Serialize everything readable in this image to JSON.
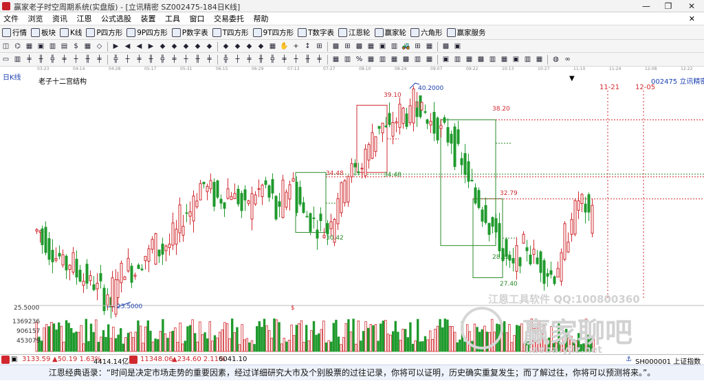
{
  "window": {
    "title": "赢家老子时空周期系统(实盘版) - [立讯精密  SZ002475-184日K线]",
    "min_label": "—",
    "max_label": "❐",
    "close_label": "✕"
  },
  "menu": [
    "文件",
    "浏览",
    "资讯",
    "江恩",
    "公式选股",
    "装置",
    "工具",
    "窗口",
    "交易委托",
    "帮助"
  ],
  "toolbar1": [
    {
      "label": "行情",
      "icon": "quote-icon"
    },
    {
      "label": "板块",
      "icon": "sector-icon"
    },
    {
      "label": "K线",
      "icon": "kline-icon"
    },
    {
      "label": "P四方形",
      "icon": "square-icon"
    },
    {
      "label": "9P四方形",
      "icon": "square9p-icon"
    },
    {
      "label": "P数字表",
      "icon": "number-table-icon"
    },
    {
      "label": "T四方形",
      "icon": "t-square-icon"
    },
    {
      "label": "9T四方形",
      "icon": "t-square9-icon"
    },
    {
      "label": "T数字表",
      "icon": "t-number-icon"
    },
    {
      "label": "江恩轮",
      "icon": "gann-wheel-icon"
    },
    {
      "label": "赢家轮",
      "icon": "winner-wheel-icon"
    },
    {
      "label": "六角形",
      "icon": "hexagon-icon"
    },
    {
      "label": "赢家服务",
      "icon": "service-icon"
    }
  ],
  "toolbar2": [
    "◫",
    "⌬",
    "▦",
    "▣",
    "▥",
    "▤",
    "$",
    "▦",
    "◇",
    "▶",
    "◀",
    "◀",
    "▶",
    "◆",
    "◆",
    "◆",
    "◆",
    "◆",
    "◆",
    "◆",
    "◆",
    "◆",
    "▦",
    "✋",
    "+",
    "↕",
    "⊞",
    "▩",
    "⊞",
    "▩",
    "▦",
    "▣",
    "▥",
    "🚜",
    "⊞",
    "▦",
    "▩",
    "▣"
  ],
  "toolbar3": [
    "▭",
    "▥",
    "╪",
    "╫",
    "╬",
    "╪",
    "┼",
    "╫",
    "╪",
    "╬",
    "┼",
    "╪",
    "╫",
    "╬",
    "╪",
    "┼",
    "╫",
    "╪",
    "╬",
    "┼",
    "╪",
    "╫",
    "╬",
    "╪",
    "┼",
    "╫",
    "╪",
    "▦",
    "▥",
    "%",
    "▦",
    "▥",
    "▦",
    "▩",
    "▥",
    "▦",
    "▣",
    "▥",
    "▦",
    "▩",
    "▥",
    "▦",
    "▣",
    "▥",
    "▦",
    "◍",
    "∞"
  ],
  "date_ruler": [
    "03-23",
    "04-14",
    "04-28",
    "05-17",
    "05-31",
    "06-15",
    "06-29",
    "07-13",
    "07-27",
    "08-10",
    "08-24",
    "09-07",
    "09-22",
    "10-13",
    "10-27",
    "11-10",
    "11-24",
    "12-08",
    "12-22"
  ],
  "chart": {
    "period_label": "日K线",
    "indicator_label": "老子十二宫结构",
    "code_label": "002475 立讯精密",
    "date_marks": [
      "11-21",
      "12-05"
    ],
    "prices": {
      "high": "40.2000",
      "low": "25.5000",
      "p39": "39.10",
      "p38": "38.20",
      "p34a": "34.48",
      "p34b": "34.48",
      "p32": "32.79",
      "p30": "30.42",
      "p28": "28.12",
      "p27": "27.40"
    },
    "axis_low": "25.5000",
    "dollar": "$",
    "volume_axis": [
      "1369236",
      "906157",
      "453079"
    ],
    "watermark_text": "江恩工具软件  QQ:100800360",
    "watermark_logo": "赢家聊吧",
    "watermark_sub": "liaoba.yjlz.net"
  },
  "chart_data": {
    "type": "candlestick",
    "x_start": "03-23",
    "x_end": "12-22",
    "ylim": [
      25.5,
      40.2
    ],
    "annotated_levels": [
      40.2,
      39.1,
      38.2,
      34.48,
      32.79,
      30.42,
      28.12,
      27.4,
      25.5
    ]
  },
  "status": {
    "sh_label": "3133.59",
    "sh_change": "▲50.19 1.63%",
    "sh_amount": "4414.14亿",
    "sz_label": "11348.06",
    "sz_change": "▲234.60 2.11%",
    "sz_amount": "6041.10",
    "index_label": "SH000001 上证指数"
  },
  "quote": "江恩经典语录：“时间是决定市场走势的重要因素，经过详细研究大市及个别股票的过往记录，你将可以证明，历史确实重复发生；而了解过往，你将可以预测将来。”。"
}
